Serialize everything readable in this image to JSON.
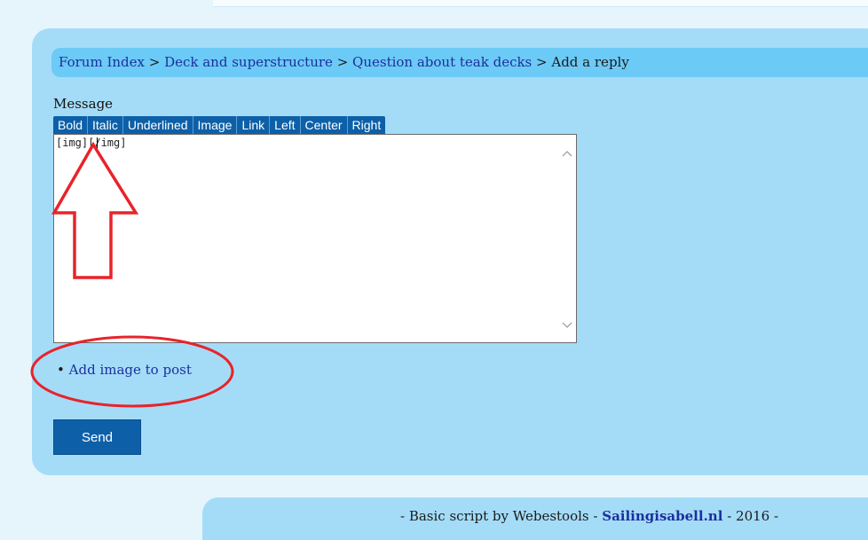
{
  "breadcrumb": {
    "items": [
      "Forum Index",
      "Deck and superstructure",
      "Question about teak decks"
    ],
    "separator": " > ",
    "current": "Add a reply"
  },
  "form": {
    "message_label": "Message",
    "toolbar": [
      "Bold",
      "Italic",
      "Underlined",
      "Image",
      "Link",
      "Left",
      "Center",
      "Right"
    ],
    "message_value": "[img][/img]",
    "add_image_bullet": "•",
    "add_image_link": "Add image to post",
    "send_label": "Send"
  },
  "footer": {
    "prefix": "- Basic script by Webestools -",
    "site": "Sailingisabell.nl",
    "suffix": "- 2016 -"
  },
  "colors": {
    "panel": "#a4dcf8",
    "crumbbar": "#6ccaf6",
    "button": "#0d60a8",
    "link": "#1c2f9e",
    "annotation": "#e8232a"
  },
  "annotations": [
    "red-arrow-up",
    "red-ellipse"
  ]
}
